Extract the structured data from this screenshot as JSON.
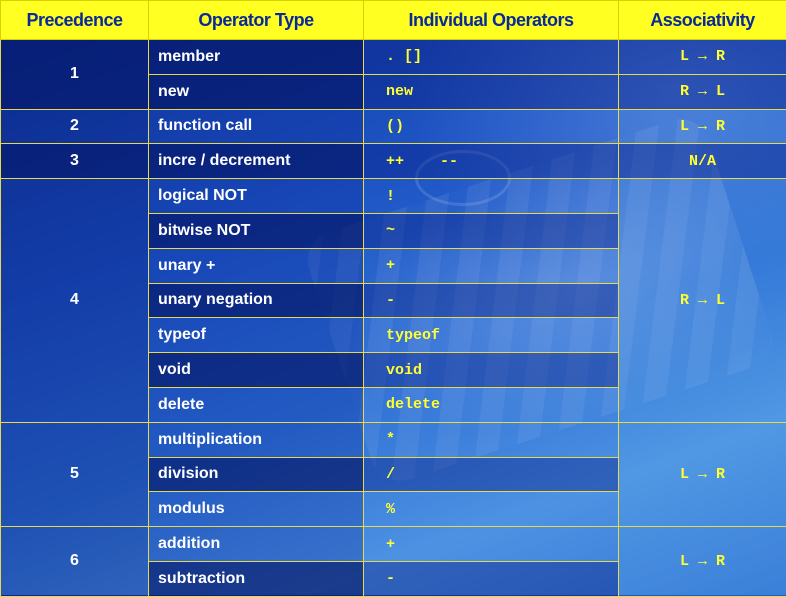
{
  "headers": [
    "Precedence",
    "Operator Type",
    "Individual Operators",
    "Associativity"
  ],
  "groups": [
    {
      "precedence": "1",
      "associativity_merged": false,
      "rows": [
        {
          "type": "member",
          "ops": ". []",
          "assoc": "L → R"
        },
        {
          "type": "new",
          "ops": "new",
          "assoc": "R → L"
        }
      ]
    },
    {
      "precedence": "2",
      "rows": [
        {
          "type": "function call",
          "ops": "()",
          "assoc": "L → R"
        }
      ]
    },
    {
      "precedence": "3",
      "rows": [
        {
          "type": "incre / decrement",
          "ops": "++    --",
          "assoc": "N/A"
        }
      ]
    },
    {
      "precedence": "4",
      "assoc": "R → L",
      "rows": [
        {
          "type": "logical NOT",
          "ops": "!"
        },
        {
          "type": "bitwise NOT",
          "ops": "~"
        },
        {
          "type": "unary +",
          "ops": "+"
        },
        {
          "type": "unary negation",
          "ops": "-"
        },
        {
          "type": "typeof",
          "ops": "typeof"
        },
        {
          "type": "void",
          "ops": "void"
        },
        {
          "type": "delete",
          "ops": "delete"
        }
      ]
    },
    {
      "precedence": "5",
      "assoc": "L → R",
      "rows": [
        {
          "type": "multiplication",
          "ops": "*"
        },
        {
          "type": "division",
          "ops": "/"
        },
        {
          "type": "modulus",
          "ops": "%"
        }
      ]
    },
    {
      "precedence": "6",
      "assoc": "L → R",
      "rows": [
        {
          "type": "addition",
          "ops": "+"
        },
        {
          "type": "subtraction",
          "ops": "-"
        }
      ]
    }
  ],
  "colors": {
    "header_bg": "#ffff22",
    "header_text": "#0a2a9a",
    "ops_text": "#ffff33",
    "border": "#e8d84a"
  }
}
